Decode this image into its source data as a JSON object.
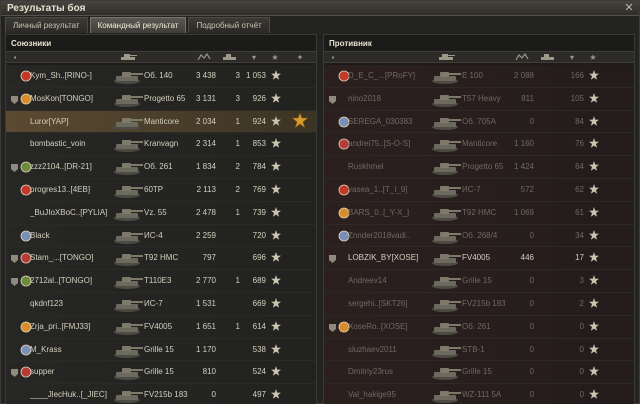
{
  "window": {
    "title": "Результаты боя"
  },
  "tabs": [
    {
      "label": "Личный результат",
      "active": false
    },
    {
      "label": "Командный результат",
      "active": true
    },
    {
      "label": "Подробный отчёт",
      "active": false
    }
  ],
  "colors": {
    "accent": "#e6e1d0",
    "ally_row": "#262624",
    "enemy_row": "#2c201f",
    "highlight_row": "#5b4a31",
    "dead_text": "#6f6a61"
  },
  "allies": {
    "title": "Союзники",
    "rows": [
      {
        "name": "Kym_Sh..[RINO-]",
        "vehicle": "Об. 140",
        "damage": "3 438",
        "kills": "3",
        "xp": "1 053",
        "me": false,
        "dead": false
      },
      {
        "name": "MosKon[TONGO]",
        "vehicle": "Progetto 65",
        "damage": "3 131",
        "kills": "3",
        "xp": "926",
        "me": false,
        "dead": false
      },
      {
        "name": "Luror[YAP]",
        "vehicle": "Manticore",
        "damage": "2 034",
        "kills": "1",
        "xp": "924",
        "me": true,
        "dead": false
      },
      {
        "name": "bombastic_voin",
        "vehicle": "Kranvagn",
        "damage": "2 314",
        "kills": "1",
        "xp": "853",
        "me": false,
        "dead": false
      },
      {
        "name": "zzz2104..[DR-21]",
        "vehicle": "Об. 261",
        "damage": "1 834",
        "kills": "2",
        "xp": "784",
        "me": false,
        "dead": false
      },
      {
        "name": "progres13..[4EB]",
        "vehicle": "60TP",
        "damage": "2 113",
        "kills": "2",
        "xp": "769",
        "me": false,
        "dead": false
      },
      {
        "name": "_BuJIoXBoC..[PYLIA]",
        "vehicle": "Vz. 55",
        "damage": "2 478",
        "kills": "1",
        "xp": "739",
        "me": false,
        "dead": false
      },
      {
        "name": "Black",
        "vehicle": "ИС-4",
        "damage": "2 259",
        "kills": "",
        "xp": "720",
        "me": false,
        "dead": false
      },
      {
        "name": "Stam_...[TONGO]",
        "vehicle": "T92 HMC",
        "damage": "797",
        "kills": "",
        "xp": "696",
        "me": false,
        "dead": false
      },
      {
        "name": "2712al..[TONGO]",
        "vehicle": "T110E3",
        "damage": "2 770",
        "kills": "1",
        "xp": "689",
        "me": false,
        "dead": false
      },
      {
        "name": "qkdnf123",
        "vehicle": "ИС-7",
        "damage": "1 531",
        "kills": "",
        "xp": "669",
        "me": false,
        "dead": false
      },
      {
        "name": "Zrja_pri..[FMJ33]",
        "vehicle": "FV4005",
        "damage": "1 651",
        "kills": "1",
        "xp": "614",
        "me": false,
        "dead": false
      },
      {
        "name": "M_Krass",
        "vehicle": "Grille 15",
        "damage": "1 170",
        "kills": "",
        "xp": "538",
        "me": false,
        "dead": false
      },
      {
        "name": "supper",
        "vehicle": "Grille 15",
        "damage": "810",
        "kills": "",
        "xp": "524",
        "me": false,
        "dead": false
      },
      {
        "name": "____JlecHuk..[_JIEC]",
        "vehicle": "FV215b 183",
        "damage": "0",
        "kills": "",
        "xp": "497",
        "me": false,
        "dead": false
      }
    ]
  },
  "enemies": {
    "title": "Противник",
    "rows": [
      {
        "name": "D_E_C_...[PRoFY]",
        "vehicle": "E 100",
        "damage": "2 088",
        "kills": "",
        "xp": "166",
        "dead": true
      },
      {
        "name": "nino2018",
        "vehicle": "T57 Heavy",
        "damage": "811",
        "kills": "",
        "xp": "105",
        "dead": true
      },
      {
        "name": "SEREGA_030383",
        "vehicle": "Об. 705А",
        "damage": "0",
        "kills": "",
        "xp": "84",
        "dead": true
      },
      {
        "name": "andrei75..[S-O-S]",
        "vehicle": "Manticore",
        "damage": "1 160",
        "kills": "",
        "xp": "76",
        "dead": true
      },
      {
        "name": "Ruskhmel",
        "vehicle": "Progetto 65",
        "damage": "1 424",
        "kills": "",
        "xp": "64",
        "dead": true
      },
      {
        "name": "vasea_1..[T_I_9]",
        "vehicle": "ИС-7",
        "damage": "572",
        "kills": "",
        "xp": "62",
        "dead": true
      },
      {
        "name": "BARS_0..[_Y-X_]",
        "vehicle": "T92 HMC",
        "damage": "1 069",
        "kills": "",
        "xp": "61",
        "dead": true
      },
      {
        "name": "Znnder2018vadi..",
        "vehicle": "Об. 268/4",
        "damage": "0",
        "kills": "",
        "xp": "34",
        "dead": true
      },
      {
        "name": "LOBZIK_BY[XOSE]",
        "vehicle": "FV4005",
        "damage": "446",
        "kills": "",
        "xp": "17",
        "dead": false
      },
      {
        "name": "Andreev14",
        "vehicle": "Grille 15",
        "damage": "0",
        "kills": "",
        "xp": "3",
        "dead": true
      },
      {
        "name": "sergehi..[SKT26]",
        "vehicle": "FV215b 183",
        "damage": "0",
        "kills": "",
        "xp": "2",
        "dead": true
      },
      {
        "name": "XoseRo..[XOSE]",
        "vehicle": "Об. 261",
        "damage": "0",
        "kills": "",
        "xp": "0",
        "dead": true
      },
      {
        "name": "sluzhaev2011",
        "vehicle": "STB-1",
        "damage": "0",
        "kills": "",
        "xp": "0",
        "dead": true
      },
      {
        "name": "Dmitriy23rus",
        "vehicle": "Grille 15",
        "damage": "0",
        "kills": "",
        "xp": "0",
        "dead": true
      },
      {
        "name": "Val_hakige95",
        "vehicle": "WZ-111 5A",
        "damage": "0",
        "kills": "",
        "xp": "0",
        "dead": true
      }
    ]
  },
  "icons": {
    "close": "close-icon",
    "platoon": "platoon-icon",
    "clan": "clan-emblem-icon",
    "tank": "tank-silhouette-icon",
    "xp": "experience-star-icon",
    "medal": "mastery-medal-icon"
  }
}
